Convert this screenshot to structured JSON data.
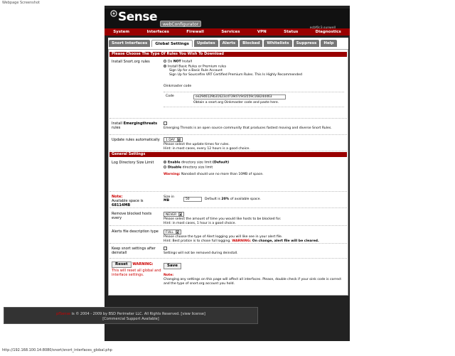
{
  "screenshot_label": "Webpage Screenshot",
  "header": {
    "logo_text": "Sense",
    "webconfigurator": "webConfigurator",
    "hostname": "ecbf0c3.sunwell"
  },
  "nav": [
    "System",
    "Interfaces",
    "Firewall",
    "Services",
    "VPN",
    "Status",
    "Diagnostics"
  ],
  "tabs": [
    "Snort Interfaces",
    "Global Settings",
    "Updates",
    "Alerts",
    "Blocked",
    "Whitelists",
    "Suppress",
    "Help"
  ],
  "active_tab": "Global Settings",
  "sections": {
    "rules": "Please Choose The Type Of Rules You Wish To Download",
    "general": "General Settings"
  },
  "install_rules": {
    "label": "Install Snort.org rules",
    "opt1_pre": "Do ",
    "opt1_bold": "NOT",
    "opt1_post": " Install",
    "opt2": "Install Basic Rules or Premium rules",
    "sub1": "Sign Up for a Basic Rule Account",
    "sub2": "Sign Up for Sourcefire VRT Certified Premium Rules. This Is Highly Recommended",
    "oinkcode_label": "Oinkmaster code",
    "code_label": "Code",
    "code_value": "ee2946129b31623cd739d7c9d3559c16824d463",
    "code_hint": "Obtain a snort.org Oinkmaster code and paste here."
  },
  "emerging": {
    "label_pre": "Install ",
    "label_bold": "Emergingthreats",
    "label_post": " rules",
    "hint": "Emerging Threats is an open source community that produces fastest moving and diverse Snort Rules."
  },
  "update": {
    "label": "Update rules automatically",
    "value": "1 DAY",
    "hint1": "Please select the update times for rules.",
    "hint2": "Hint: in most cases, every 12 hours is a good choice."
  },
  "log_dir": {
    "label": "Log Directory Size Limit",
    "opt1_bold": "Enable",
    "opt1_post": " directory size limit ",
    "opt1_default": "(Default)",
    "opt2_bold": "Disable",
    "opt2_post": " directory size limit",
    "warning_bold": "Warning:",
    "warning_text": " Nanobsd should use no more than 10MB of space."
  },
  "note_space": {
    "note": "Note:",
    "available": "Available space is",
    "size": "68114MB",
    "size_label1": "Size in",
    "size_label2": "MB",
    "size_value": "50",
    "default_pre": "Default is ",
    "default_bold": "20%",
    "default_post": " of available space."
  },
  "remove_blocked": {
    "label": "Remove blocked hosts every",
    "value": "NEVER",
    "hint1": "Please select the amount of time you would like hosts to be blocked for.",
    "hint2": "Hint: in most cases, 1 hour is a good choice."
  },
  "alerts_file": {
    "label": "Alerts file description type",
    "value": "FULL",
    "hint1": "Please choose the type of Alert logging you will like see in your alert file.",
    "hint2": "Hint: Best pratice is to chose full logging. ",
    "warning_red": "WARNING:",
    "warning_bold": " On change, alert file will be cleared."
  },
  "keep_settings": {
    "label": "Keep snort settings after deinstall",
    "hint": "Settings will not be removed during deinstall."
  },
  "reset": {
    "button": "Reset",
    "warning": "WARNING:",
    "desc": "This will reset all global and interface settings."
  },
  "save": {
    "button": "Save",
    "note": "Note:",
    "note_text": "Changing any settings on this page will affect all interfaces. Please, double check if your oink code is correct and the type of snort.org account you hold."
  },
  "footer": {
    "brand": "pfSense",
    "copyright": " is © 2004 - 2009 by BSD Perimeter LLC. All Rights Reserved. [view license]",
    "support": "[Commercial Support Available]"
  },
  "status_url": "http://192.168.100.14:8080/snort/snort_interfaces_global.php"
}
